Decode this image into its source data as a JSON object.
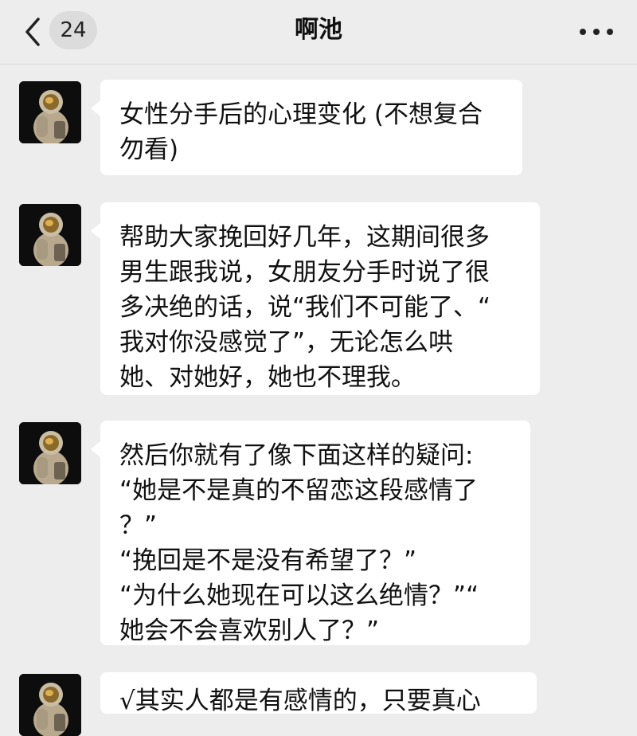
{
  "header": {
    "back_icon": "chevron-left-icon",
    "unread_count": "24",
    "title": "啊池",
    "more_icon": "more-dots-icon"
  },
  "messages": [
    {
      "sender": "astronaut-avatar",
      "text": "女性分手后的心理变化 (不想复合\n勿看)"
    },
    {
      "sender": "astronaut-avatar",
      "text": "帮助大家挽回好几年，这期间很多\n男生跟我说，女朋友分手时说了很\n多决绝的话，说“我们不可能了、“\n我对你没感觉了”，无论怎么哄\n她、对她好，她也不理我。"
    },
    {
      "sender": "astronaut-avatar",
      "text": "然后你就有了像下面这样的疑问:\n“她是不是真的不留恋这段感情了\n？”\n“挽回是不是没有希望了？”\n“为什么她现在可以这么绝情？”“\n她会不会喜欢别人了？”"
    },
    {
      "sender": "astronaut-avatar",
      "text": "√其实人都是有感情的，只要真心"
    }
  ],
  "colors": {
    "background": "#ededed",
    "bubble": "#ffffff",
    "text": "#111111"
  }
}
